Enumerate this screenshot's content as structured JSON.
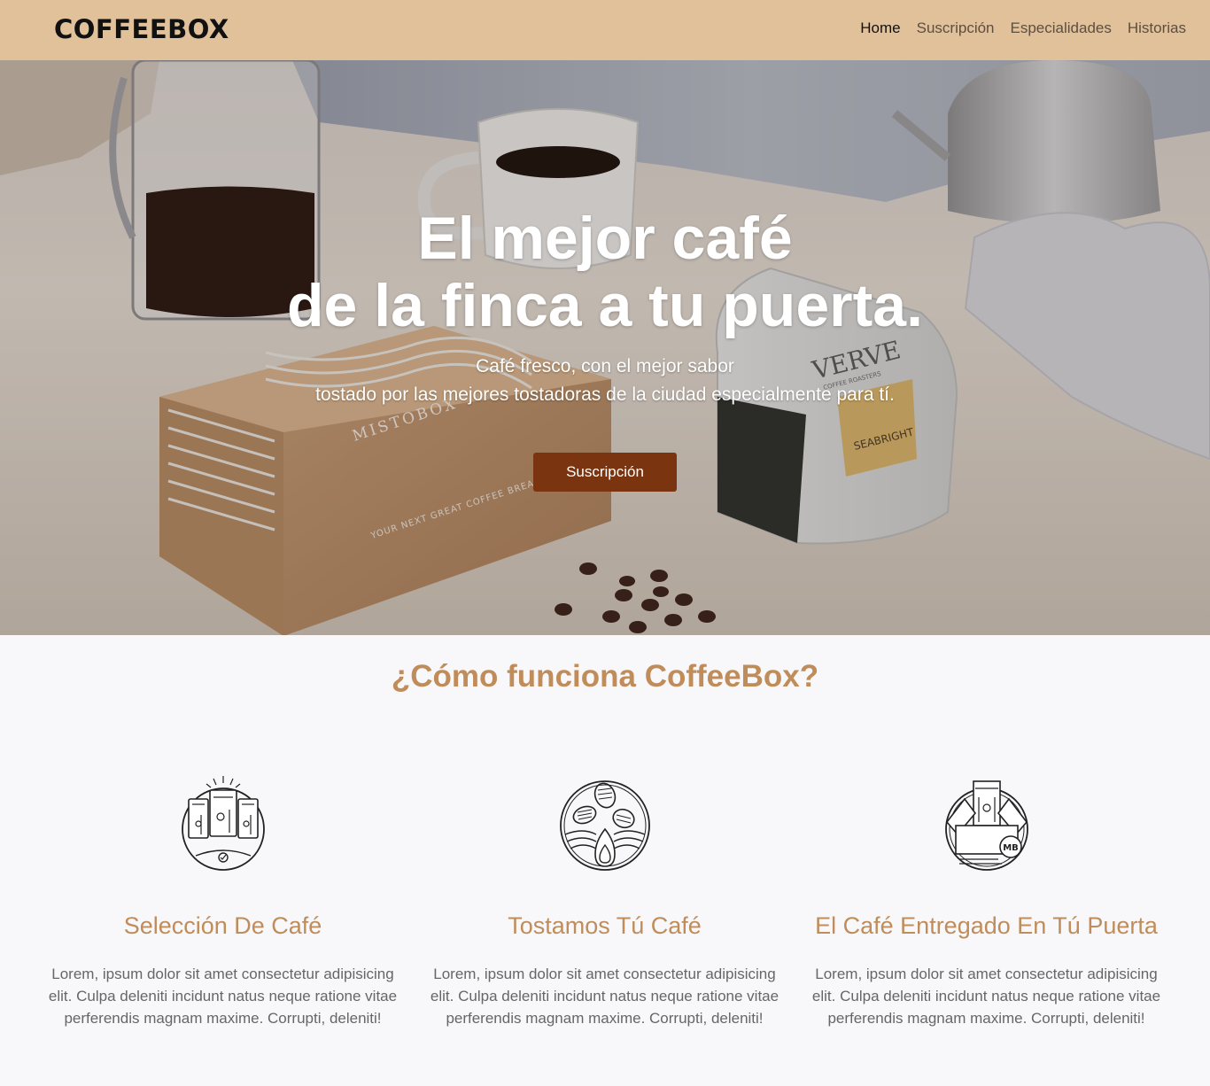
{
  "navbar": {
    "brand": "COFFEEBOX",
    "links": [
      {
        "label": "Home",
        "active": true
      },
      {
        "label": "Suscripción",
        "active": false
      },
      {
        "label": "Especialidades",
        "active": false
      },
      {
        "label": "Historias",
        "active": false
      }
    ]
  },
  "hero": {
    "title_line1": "El mejor café",
    "title_line2": "de la finca a tu puerta.",
    "subtitle_line1": "Café fresco, con el mejor sabor",
    "subtitle_line2": "tostado por las mejores tostadoras de la ciudad especialmente para tí.",
    "cta_label": "Suscripción",
    "image_labels": {
      "box_brand": "MISTOBOX",
      "box_tagline": "YOUR NEXT GREAT COFFEE BREAK HAS ARRIVED.",
      "bag_brand": "VERVE",
      "bag_sub": "COFFEE ROASTERS",
      "bag_label": "SEABRIGHT"
    }
  },
  "how": {
    "title": "¿Cómo funciona CoffeeBox?",
    "steps": [
      {
        "icon": "coffee-bags-icon",
        "title": "Selección De Café",
        "text": "Lorem, ipsum dolor sit amet consectetur adipisicing elit. Culpa deleniti incidunt natus neque ratione vitae perferendis magnam maxime. Corrupti, deleniti!"
      },
      {
        "icon": "roasting-beans-icon",
        "title": "Tostamos Tú Café",
        "text": "Lorem, ipsum dolor sit amet consectetur adipisicing elit. Culpa deleniti incidunt natus neque ratione vitae perferendis magnam maxime. Corrupti, deleniti!"
      },
      {
        "icon": "delivery-box-icon",
        "title": "El Café Entregado En Tú Puerta",
        "text": "Lorem, ipsum dolor sit amet consectetur adipisicing elit. Culpa deleniti incidunt natus neque ratione vitae perferendis magnam maxime. Corrupti, deleniti!",
        "icon_text": "MB"
      }
    ]
  },
  "colors": {
    "navbar_bg": "#e1c19a",
    "accent": "#c08d5a",
    "cta_bg": "#7a3410",
    "page_bg": "#f8f8fa"
  }
}
